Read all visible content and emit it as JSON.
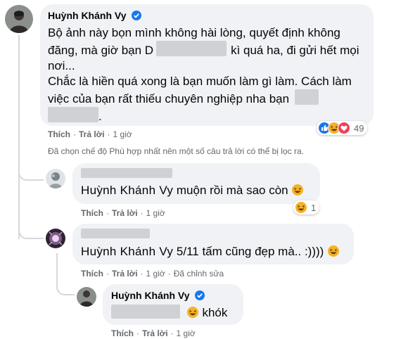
{
  "main_comment": {
    "author": "Huỳnh Khánh Vy",
    "text_line1": "Bộ ảnh này bọn mình không hài lòng, quyết định không",
    "text_line2a": "đăng, mà giờ bạn D",
    "text_line2b": "kì quá ha, đi gửi hết mọi",
    "text_line3": "nơi...",
    "text_line4": "Chắc là hiền quá xong là bạn muốn làm gì làm. Cách làm",
    "text_line5": "việc của bạn rất thiếu chuyên nghiệp nha bạn",
    "text_line6": ".",
    "like_label": "Thích",
    "reply_label": "Trả lời",
    "time": "1 giờ",
    "reaction_count": "49",
    "reaction_icons": [
      "like-icon",
      "haha-icon",
      "love-icon"
    ]
  },
  "filter_note": "Đã chọn chế độ Phù hợp nhất nên một số câu trả lời có thể bị lọc ra.",
  "reply1": {
    "mention": "Huỳnh Khánh Vy",
    "text": "muộn rồi mà sao còn",
    "like_label": "Thích",
    "reply_label": "Trả lời",
    "time": "1 giờ",
    "reaction_count": "1"
  },
  "reply2": {
    "mention": "Huỳnh Khánh Vy",
    "text": "5/11 tấm cũng đẹp mà.. :))))",
    "like_label": "Thích",
    "reply_label": "Trả lời",
    "time": "1 giờ",
    "edited": "Đã chỉnh sửa"
  },
  "reply3": {
    "author": "Huỳnh Khánh Vy",
    "text": "khók",
    "like_label": "Thích",
    "reply_label": "Trả lời",
    "time": "1 giờ"
  },
  "colors": {
    "bubble": "#f0f2f5",
    "verified": "#1877f2",
    "meta": "#65676b",
    "blur": "#cfd1d4"
  }
}
